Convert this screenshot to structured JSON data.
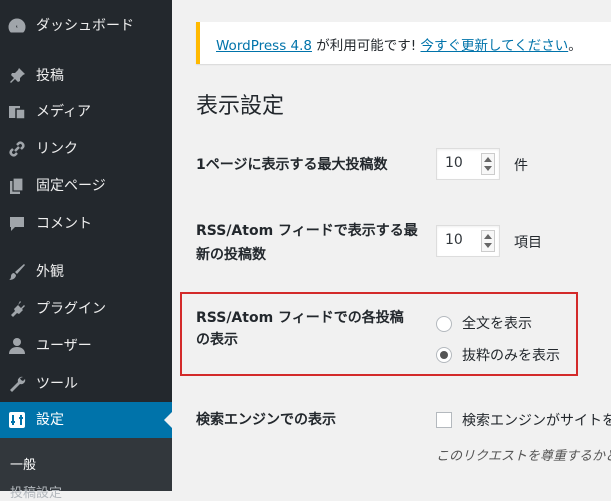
{
  "sidebar": {
    "items": [
      {
        "label": "ダッシュボード",
        "icon": "dashboard-icon"
      },
      {
        "label": "投稿",
        "icon": "pin-icon"
      },
      {
        "label": "メディア",
        "icon": "media-icon"
      },
      {
        "label": "リンク",
        "icon": "link-icon"
      },
      {
        "label": "固定ページ",
        "icon": "page-icon"
      },
      {
        "label": "コメント",
        "icon": "comment-icon"
      },
      {
        "label": "外観",
        "icon": "brush-icon"
      },
      {
        "label": "プラグイン",
        "icon": "plugin-icon"
      },
      {
        "label": "ユーザー",
        "icon": "user-icon"
      },
      {
        "label": "ツール",
        "icon": "wrench-icon"
      },
      {
        "label": "設定",
        "icon": "settings-icon"
      }
    ],
    "submenu": [
      "一般",
      "投稿設定"
    ]
  },
  "notice": {
    "link_text": "WordPress 4.8",
    "middle": " が利用可能です! ",
    "action_link": "今すぐ更新してください",
    "end": "。"
  },
  "page_title": "表示設定",
  "settings": {
    "posts_per_page": {
      "label": "1ページに表示する最大投稿数",
      "value": "10",
      "unit": "件"
    },
    "feed_posts": {
      "label_line1": "RSS/Atom フィードで表示する最",
      "label_line2": "新の投稿数",
      "value": "10",
      "unit": "項目"
    },
    "feed_display": {
      "label_line1": "RSS/Atom フィードでの各投稿",
      "label_line2": "の表示",
      "options": [
        "全文を表示",
        "抜粋のみを表示"
      ],
      "selected": 1
    },
    "search_engine": {
      "label": "検索エンジンでの表示",
      "checkbox_label": "検索エンジンがサイトをインデックスしないようにする",
      "description": "このリクエストを尊重するかどうかは検索エンジンの設定によります。"
    }
  },
  "colors": {
    "accent": "#0073aa",
    "sidebar": "#23282d",
    "highlight": "#d32a2a",
    "notice": "#ffb900"
  }
}
